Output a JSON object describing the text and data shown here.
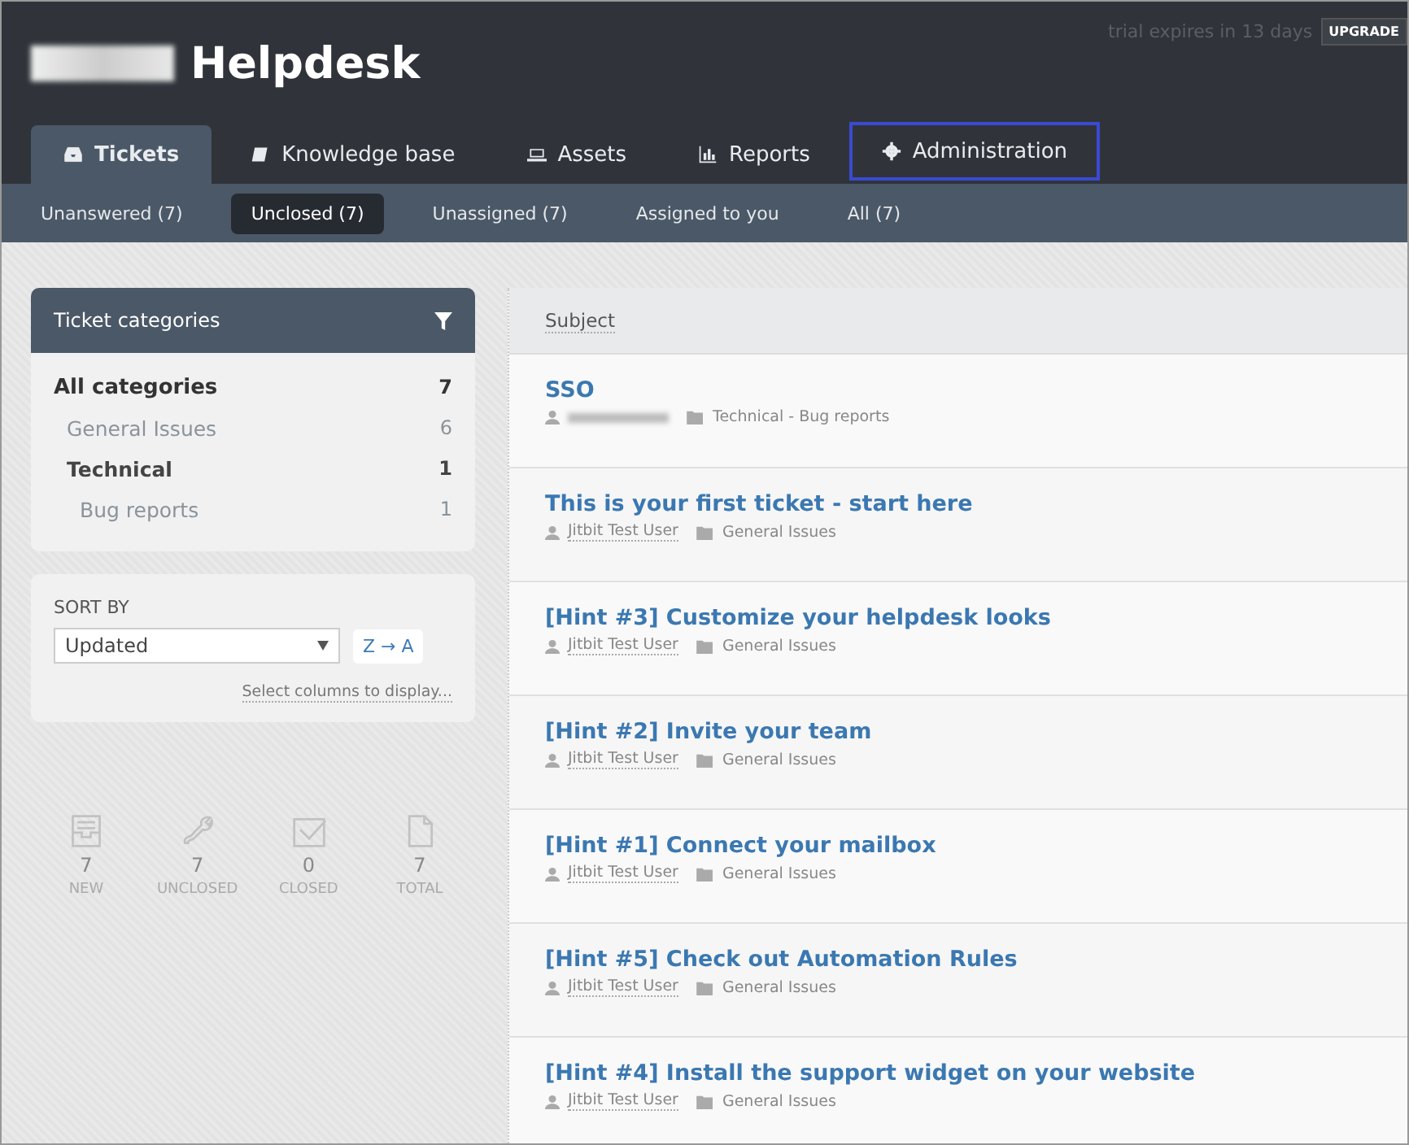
{
  "header": {
    "title": "Helpdesk",
    "trial_notice": "trial expires in 13 days",
    "upgrade_button": "UPGRADE"
  },
  "tabs": [
    {
      "label": "Tickets",
      "selected": true,
      "outlined": false
    },
    {
      "label": "Knowledge base",
      "selected": false,
      "outlined": false
    },
    {
      "label": "Assets",
      "selected": false,
      "outlined": false
    },
    {
      "label": "Reports",
      "selected": false,
      "outlined": false
    },
    {
      "label": "Administration",
      "selected": false,
      "outlined": true
    }
  ],
  "filters": [
    {
      "label": "Unanswered (7)",
      "selected": false
    },
    {
      "label": "Unclosed (7)",
      "selected": true
    },
    {
      "label": "Unassigned (7)",
      "selected": false
    },
    {
      "label": "Assigned to you",
      "selected": false
    },
    {
      "label": "All (7)",
      "selected": false
    }
  ],
  "categories": {
    "title": "Ticket categories",
    "items": [
      {
        "name": "All categories",
        "count": "7",
        "children": [
          {
            "name": "General Issues",
            "count": "6"
          },
          {
            "name": "Technical",
            "count": "1",
            "children": [
              {
                "name": "Bug reports",
                "count": "1"
              }
            ]
          }
        ]
      }
    ]
  },
  "sort": {
    "label": "SORT BY",
    "value": "Updated",
    "order_button": "Z → A",
    "columns_link": "Select columns to display..."
  },
  "stats": [
    {
      "value": "7",
      "label": "NEW"
    },
    {
      "value": "7",
      "label": "UNCLOSED"
    },
    {
      "value": "0",
      "label": "CLOSED"
    },
    {
      "value": "7",
      "label": "TOTAL"
    }
  ],
  "table": {
    "columns": [
      "Subject"
    ],
    "rows": [
      {
        "subject": "SSO",
        "category": "Technical - Bug reports"
      },
      {
        "subject": "This is your first ticket - start here",
        "author": "Jitbit Test User",
        "category": "General Issues"
      },
      {
        "subject": "[Hint #3] Customize your helpdesk looks",
        "author": "Jitbit Test User",
        "category": "General Issues"
      },
      {
        "subject": "[Hint #2] Invite your team",
        "author": "Jitbit Test User",
        "category": "General Issues"
      },
      {
        "subject": "[Hint #1] Connect your mailbox",
        "author": "Jitbit Test User",
        "category": "General Issues"
      },
      {
        "subject": "[Hint #5] Check out Automation Rules",
        "author": "Jitbit Test User",
        "category": "General Issues"
      },
      {
        "subject": "[Hint #4] Install the support widget on your website",
        "author": "Jitbit Test User",
        "category": "General Issues"
      }
    ]
  }
}
